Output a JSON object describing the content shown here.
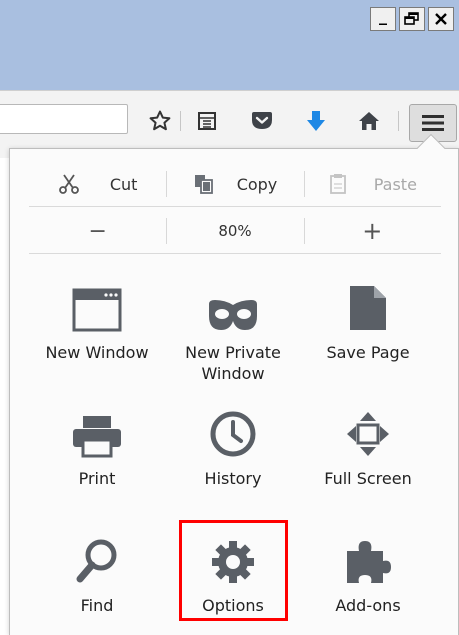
{
  "window_controls": {
    "minimize": "_",
    "restore": "restore-icon",
    "close": "close-icon"
  },
  "toolbar": {
    "url_value": "",
    "icons": [
      "star-icon",
      "reading-list-icon",
      "pocket-icon",
      "download-arrow-icon",
      "home-icon",
      "hamburger-menu-icon"
    ]
  },
  "menu": {
    "edit": {
      "cut": "Cut",
      "copy": "Copy",
      "paste": "Paste",
      "paste_disabled": true
    },
    "zoom": {
      "minus": "−",
      "value": "80%",
      "plus": "+"
    },
    "tiles": [
      {
        "label": "New Window",
        "icon": "new-window-icon"
      },
      {
        "label": "New Private Window",
        "icon": "private-mask-icon"
      },
      {
        "label": "Save Page",
        "icon": "save-page-icon"
      },
      {
        "label": "Print",
        "icon": "printer-icon"
      },
      {
        "label": "History",
        "icon": "clock-icon"
      },
      {
        "label": "Full Screen",
        "icon": "full-screen-icon"
      },
      {
        "label": "Find",
        "icon": "magnifier-icon"
      },
      {
        "label": "Options",
        "icon": "gear-icon"
      },
      {
        "label": "Add-ons",
        "icon": "puzzle-icon"
      }
    ],
    "highlighted_item": "Options"
  },
  "colors": {
    "titlebar": "#a9bfe0",
    "highlight": "#ff0000",
    "download_accent": "#1e88e5",
    "icon_gray": "#5a5f66"
  }
}
